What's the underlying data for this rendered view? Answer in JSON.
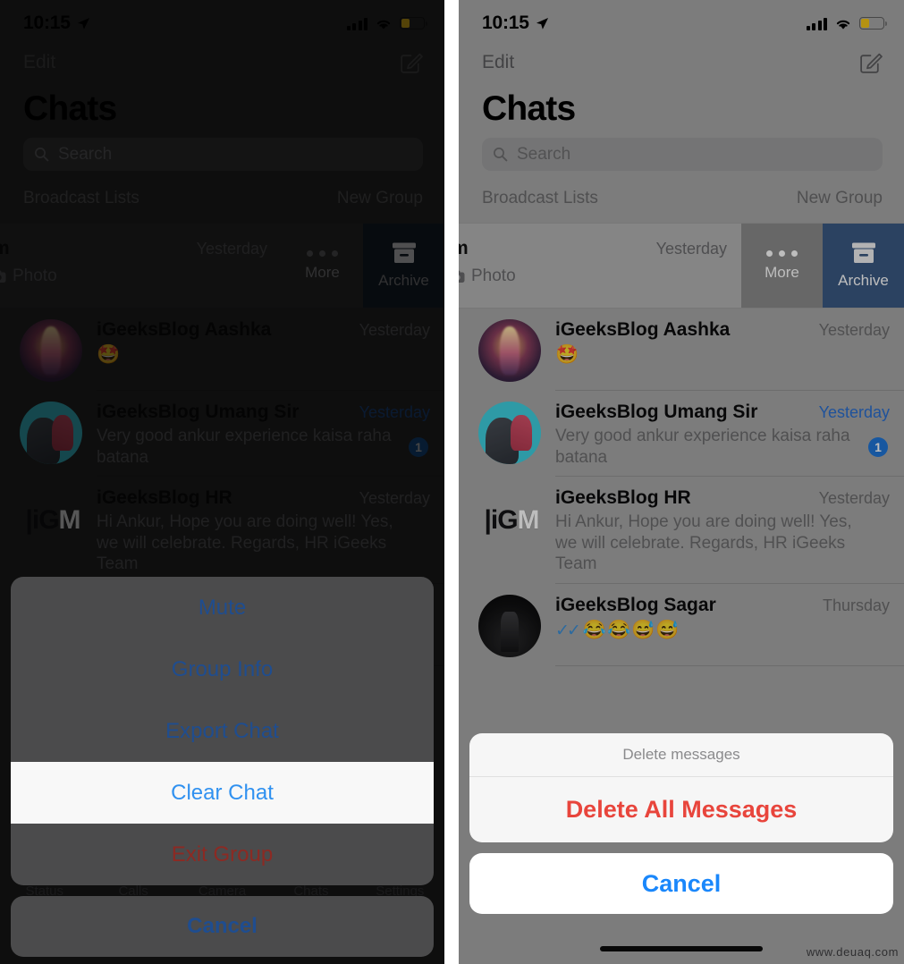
{
  "status_bar": {
    "time": "10:15",
    "location_icon": "location-arrow-icon",
    "signal_icon": "cellular-bars-icon",
    "wifi_icon": "wifi-icon",
    "battery_icon": "battery-icon"
  },
  "nav": {
    "edit_label": "Edit",
    "compose_icon": "compose-icon",
    "title": "Chats"
  },
  "search": {
    "placeholder": "Search",
    "icon": "search-icon"
  },
  "list_header": {
    "broadcast_lists": "Broadcast Lists",
    "new_group": "New Group"
  },
  "swiped_row": {
    "name_fragment": "m",
    "time": "Yesterday",
    "snippet": "Photo",
    "camera_icon": "camera-icon",
    "more_label": "More",
    "more_icon": "ellipsis-icon",
    "archive_label": "Archive",
    "archive_icon": "archive-box-icon"
  },
  "chats": [
    {
      "name": "iGeeksBlog Aashka",
      "time": "Yesterday",
      "time_accent": false,
      "snippet": "",
      "emoji": "🤩",
      "badge": "",
      "avatar": "avatar-aashka"
    },
    {
      "name": "iGeeksBlog Umang Sir",
      "time": "Yesterday",
      "time_accent": true,
      "snippet": "Very good ankur experience kaisa raha batana",
      "emoji": "",
      "badge": "1",
      "avatar": "avatar-umang"
    },
    {
      "name": "iGeeksBlog HR",
      "time": "Yesterday",
      "time_accent": false,
      "snippet": "Hi Ankur, Hope you are doing well! Yes, we will celebrate.  Regards, HR iGeeks Team",
      "emoji": "",
      "badge": "",
      "avatar": "avatar-igm-logo",
      "logo_text": {
        "pipe": "|",
        "ig": "iG",
        "m": "M"
      }
    },
    {
      "name": "iGeeksBlog Sagar",
      "time": "Thursday",
      "time_accent": false,
      "snippet": "",
      "ticks": "✓✓",
      "emoji": "😂😂😅😅",
      "badge": "",
      "avatar": "avatar-sagar"
    }
  ],
  "tab_bar": {
    "tabs": [
      {
        "label": "Status"
      },
      {
        "label": "Calls"
      },
      {
        "label": "Camera"
      },
      {
        "label": "Chats"
      },
      {
        "label": "Settings"
      }
    ]
  },
  "left_sheet": {
    "items": [
      {
        "label": "Mute",
        "style": "default"
      },
      {
        "label": "Group Info",
        "style": "default"
      },
      {
        "label": "Export Chat",
        "style": "default"
      },
      {
        "label": "Clear Chat",
        "style": "highlight"
      },
      {
        "label": "Exit Group",
        "style": "destructive"
      }
    ],
    "cancel_label": "Cancel"
  },
  "right_sheet": {
    "title": "Delete messages",
    "confirm_label": "Delete All Messages",
    "cancel_label": "Cancel"
  },
  "watermark": "www.deuaq.com",
  "colors": {
    "ios_blue": "#1a87fb",
    "destructive_red": "#e8453c",
    "badge_blue": "#1f76d8",
    "archive_blue": "#3b5a84",
    "battery_yellow": "#f5c518",
    "tick_blue": "#3d8fd6"
  }
}
